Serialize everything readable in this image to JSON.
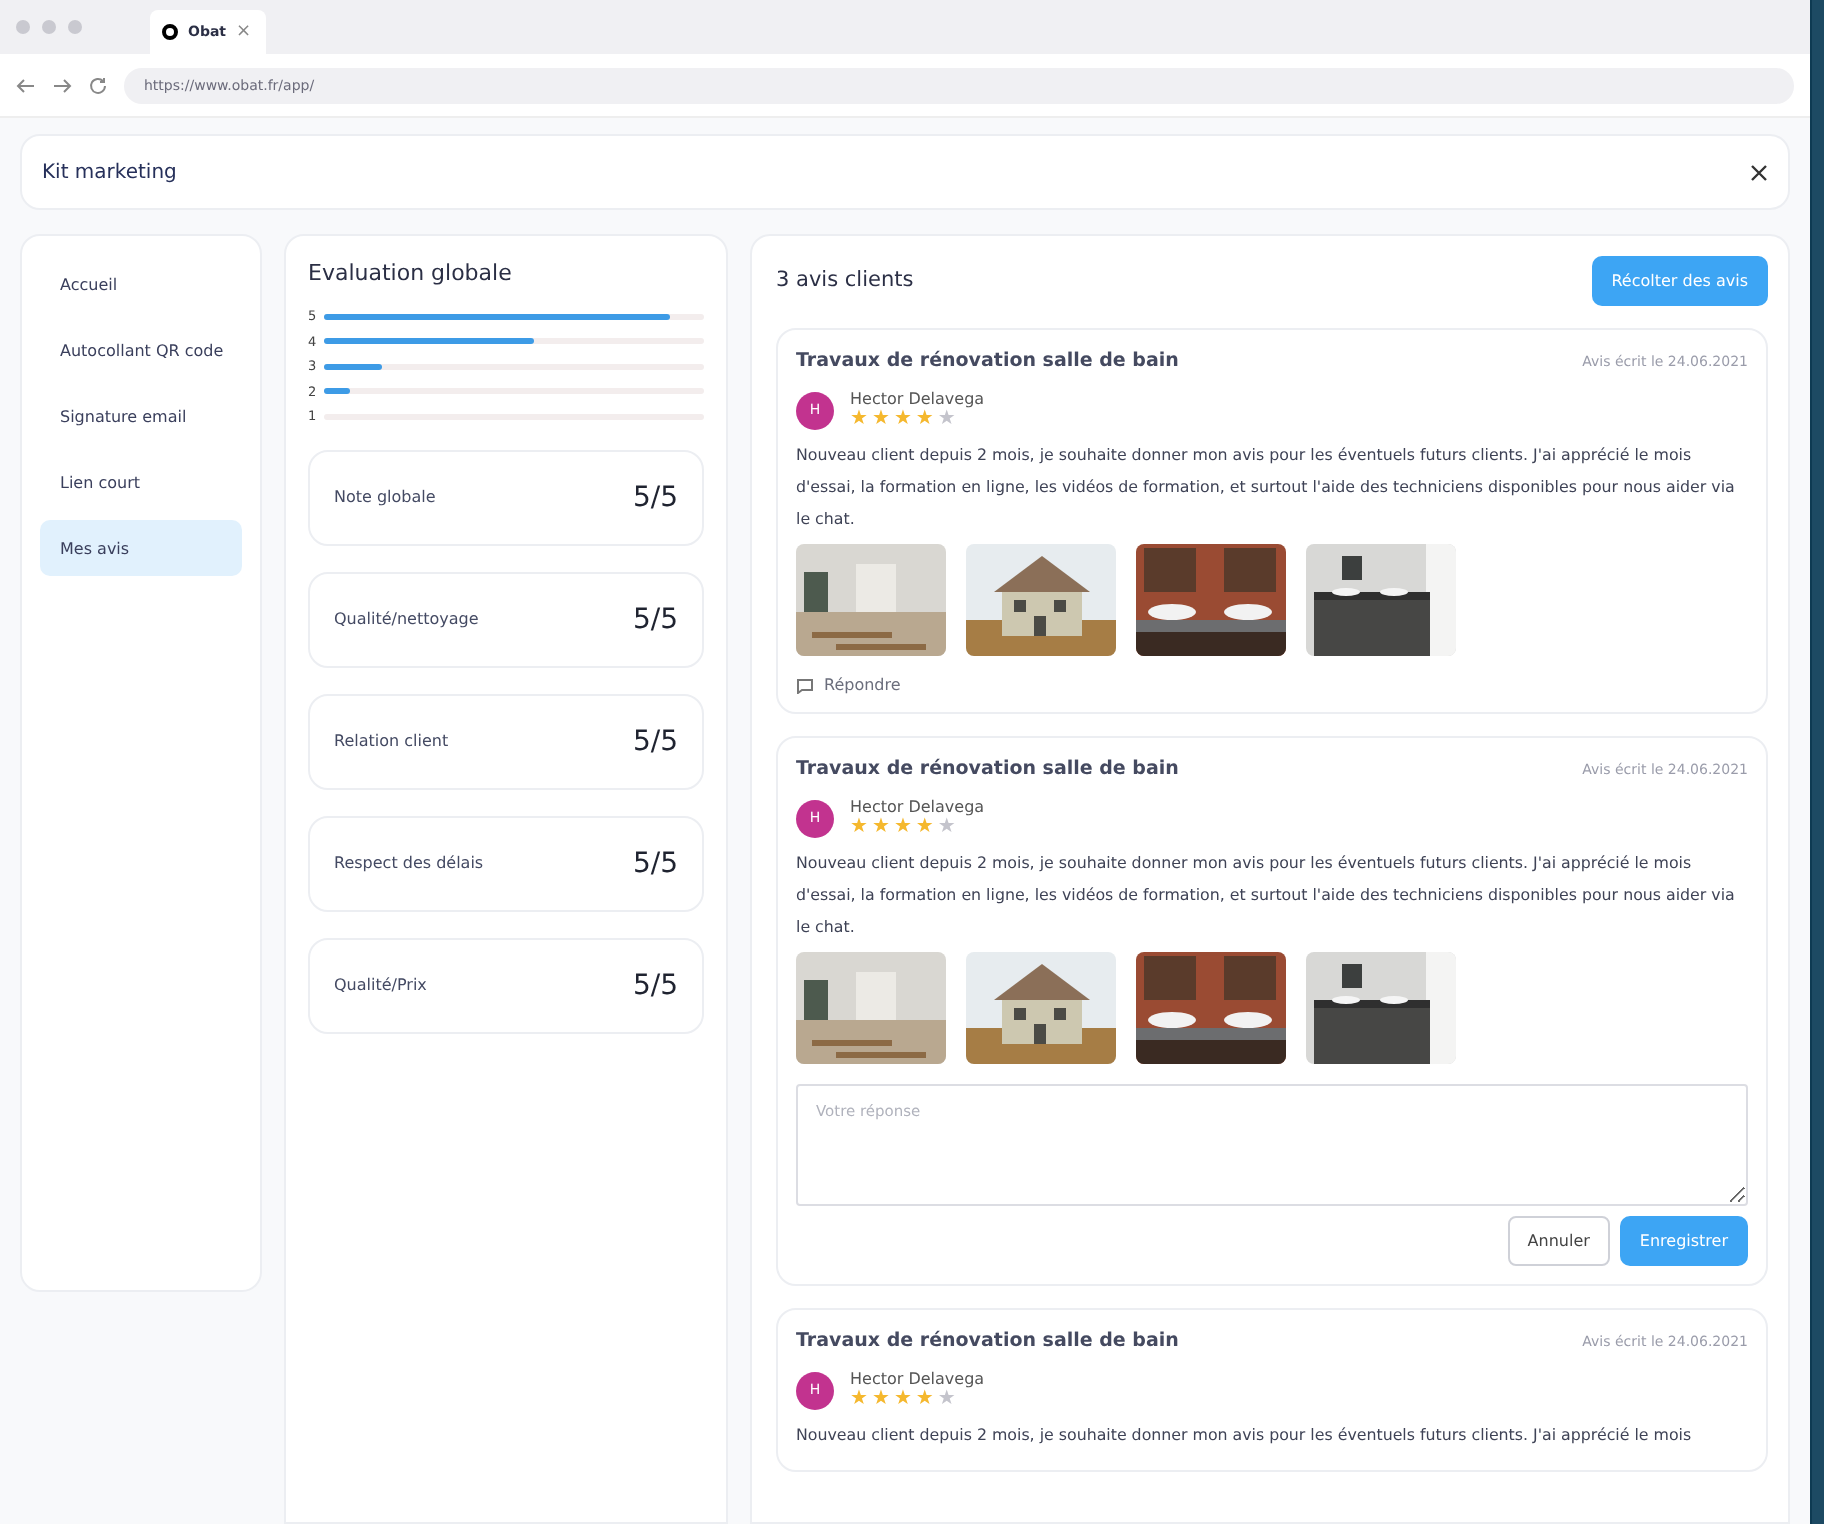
{
  "browser": {
    "tab_title": "Obat",
    "tab_close": "×",
    "url": "https://www.obat.fr/app/"
  },
  "header": {
    "title": "Kit marketing"
  },
  "sidebar": {
    "items": [
      {
        "label": "Accueil",
        "selected": false
      },
      {
        "label": "Autocollant QR code",
        "selected": false
      },
      {
        "label": "Signature email",
        "selected": false
      },
      {
        "label": "Lien court",
        "selected": false
      },
      {
        "label": "Mes avis",
        "selected": true
      }
    ]
  },
  "evaluation": {
    "title": "Evaluation globale",
    "distribution": [
      {
        "label": "5",
        "level": 0.91
      },
      {
        "label": "4",
        "level": 0.55
      },
      {
        "label": "3",
        "level": 0.15
      },
      {
        "label": "2",
        "level": 0.07
      },
      {
        "label": "1"
      }
    ],
    "scores": [
      {
        "label": "Note globale",
        "value": "5/5"
      },
      {
        "label": "Qualité/nettoyage",
        "value": "5/5"
      },
      {
        "label": "Relation client",
        "value": "5/5"
      },
      {
        "label": "Respect des délais",
        "value": "5/5"
      },
      {
        "label": "Qualité/Prix",
        "value": "5/5"
      }
    ]
  },
  "reviews": {
    "title": "3 avis clients",
    "collect_button": "Récolter des avis",
    "items": [
      {
        "title": "Travaux de rénovation salle de bain",
        "date": "Avis écrit le 24.06.2021",
        "initial": "H",
        "author": "Hector Delavega",
        "stars": 4,
        "comment": "Nouveau client depuis 2 mois, je souhaite donner mon avis pour les éventuels futurs clients. J'ai apprécié le mois d'essai, la formation en ligne, les vidéos de formation, et surtout l'aide des techniciens disponibles pour nous aider via le chat.",
        "photos": [
          {
            "kind": "picture"
          },
          {
            "kind": "picture"
          },
          {
            "kind": "picture"
          },
          {
            "kind": "picture"
          }
        ],
        "reply": {
          "kind": "link",
          "label": "Répondre"
        }
      },
      {
        "title": "Travaux de rénovation salle de bain",
        "date": "Avis écrit le 24.06.2021",
        "initial": "H",
        "author": "Hector Delavega",
        "stars": 4,
        "comment": "Nouveau client depuis 2 mois, je souhaite donner mon avis pour les éventuels futurs clients. J'ai apprécié le mois d'essai, la formation en ligne, les vidéos de formation, et surtout l'aide des techniciens disponibles pour nous aider via le chat.",
        "photos": [
          {
            "kind": "picture"
          },
          {
            "kind": "picture"
          },
          {
            "kind": "picture"
          },
          {
            "kind": "picture"
          }
        ],
        "reply": {
          "kind": "form",
          "placeholder": "Votre réponse",
          "cancel": "Annuler",
          "save": "Enregistrer"
        }
      },
      {
        "title": "Travaux de rénovation salle de bain",
        "date": "Avis écrit le 24.06.2021",
        "initial": "H",
        "author": "Hector Delavega",
        "stars": 4,
        "comment": "Nouveau client depuis 2 mois, je souhaite donner mon avis pour les éventuels futurs clients. J'ai apprécié le mois"
      }
    ]
  }
}
